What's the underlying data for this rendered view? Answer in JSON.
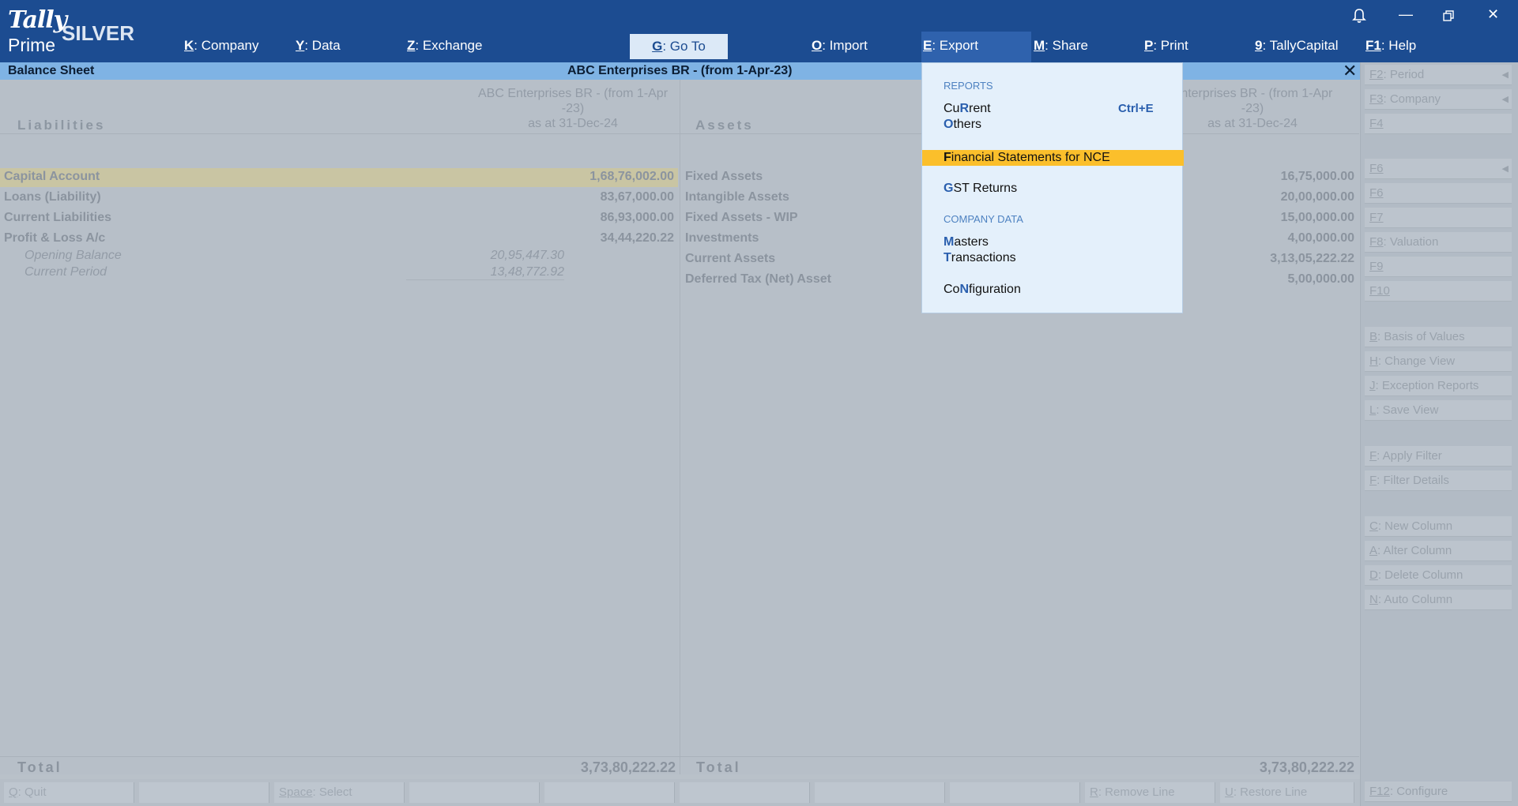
{
  "app": {
    "logo_top": "Tally",
    "logo_bottom": "Prime",
    "edition": "SILVER"
  },
  "menu": [
    {
      "key": "K",
      "label": ": Company"
    },
    {
      "key": "Y",
      "label": ": Data"
    },
    {
      "key": "Z",
      "label": ": Exchange"
    },
    {
      "key": "G",
      "label": ": Go To"
    },
    {
      "key": "O",
      "label": ": Import"
    },
    {
      "key": "E",
      "label": ": Export"
    },
    {
      "key": "M",
      "label": ": Share"
    },
    {
      "key": "P",
      "label": ": Print"
    },
    {
      "key": "9",
      "label": ": TallyCapital"
    },
    {
      "key": "F1",
      "label": ": Help"
    }
  ],
  "report": {
    "title": "Balance Sheet",
    "company_period": "ABC Enterprises BR - (from 1-Apr-23)",
    "left_col": "Liabilities",
    "right_col": "Assets",
    "company_head_l1": "ABC Enterprises BR - (from 1-Apr",
    "company_head_l2": "-23)",
    "company_head_r1": "Enterprises BR - (from 1-Apr",
    "company_head_r2": "-23)",
    "as_at": "as at 31-Dec-24",
    "liabilities": [
      {
        "name": "Capital Account",
        "amount": "1,68,76,002.00"
      },
      {
        "name": "Loans (Liability)",
        "amount": "83,67,000.00"
      },
      {
        "name": "Current Liabilities",
        "amount": "86,93,000.00"
      },
      {
        "name": "Profit & Loss A/c",
        "amount": "34,44,220.22"
      }
    ],
    "pl_sub": [
      {
        "name": "Opening Balance",
        "amount": "20,95,447.30"
      },
      {
        "name": "Current Period",
        "amount": "13,48,772.92"
      }
    ],
    "assets": [
      {
        "name": "Fixed Assets",
        "amount": "16,75,000.00"
      },
      {
        "name": "Intangible Assets",
        "amount": "20,00,000.00"
      },
      {
        "name": "Fixed Assets - WIP",
        "amount": "15,00,000.00"
      },
      {
        "name": "Investments",
        "amount": "4,00,000.00"
      },
      {
        "name": "Current Assets",
        "amount": "3,13,05,222.22"
      },
      {
        "name": "Deferred Tax (Net) Asset",
        "amount": "5,00,000.00"
      }
    ],
    "total_label": "Total",
    "total_left": "3,73,80,222.22",
    "total_right": "3,73,80,222.22"
  },
  "right_panel": [
    {
      "key": "F2",
      "label": ": Period"
    },
    {
      "key": "F3",
      "label": ": Company"
    },
    {
      "key": "F4",
      "label": ""
    },
    {
      "key": "F6",
      "label": ""
    },
    {
      "key": "F6",
      "label": ""
    },
    {
      "key": "F7",
      "label": ""
    },
    {
      "key": "F8",
      "label": ": Valuation"
    },
    {
      "key": "F9",
      "label": ""
    },
    {
      "key": "F10",
      "label": ""
    },
    {
      "key": "B",
      "label": ": Basis of Values"
    },
    {
      "key": "H",
      "label": ": Change View"
    },
    {
      "key": "J",
      "label": ": Exception Reports"
    },
    {
      "key": "L",
      "label": ": Save View"
    },
    {
      "key": "F",
      "label": ": Apply Filter"
    },
    {
      "key": "F",
      "label": ": Filter Details"
    },
    {
      "key": "C",
      "label": ": New Column"
    },
    {
      "key": "A",
      "label": ": Alter Column"
    },
    {
      "key": "D",
      "label": ": Delete Column"
    },
    {
      "key": "N",
      "label": ": Auto Column"
    },
    {
      "key": "F12",
      "label": ": Configure"
    }
  ],
  "bottom_bar": [
    {
      "key": "Q",
      "label": ": Quit"
    },
    {
      "key": "Space",
      "label": ": Select"
    },
    {
      "key": "R",
      "label": ": Remove Line"
    },
    {
      "key": "U",
      "label": ": Restore Line"
    }
  ],
  "export_menu": {
    "section_reports": "REPORTS",
    "current": {
      "pre": "Cu",
      "key": "R",
      "post": "rent",
      "shortcut": "Ctrl+E"
    },
    "others": {
      "key": "O",
      "post": "thers"
    },
    "fin_nce": {
      "key": "F",
      "post": "inancial Statements for NCE"
    },
    "gst": {
      "key": "G",
      "post": "ST Returns"
    },
    "section_company": "COMPANY DATA",
    "masters": {
      "key": "M",
      "post": "asters"
    },
    "transactions": {
      "key": "T",
      "post": "ransactions"
    },
    "configuration": {
      "pre": "Co",
      "key": "N",
      "post": "figuration"
    }
  },
  "colors": {
    "brand": "#1c4c91",
    "title_strip": "#7fb3e4",
    "highlight": "#fbbf2b",
    "menu_key": "#2a5fae"
  },
  "icons": [
    "bell-icon",
    "minimize-icon",
    "restore-icon",
    "close-icon"
  ]
}
